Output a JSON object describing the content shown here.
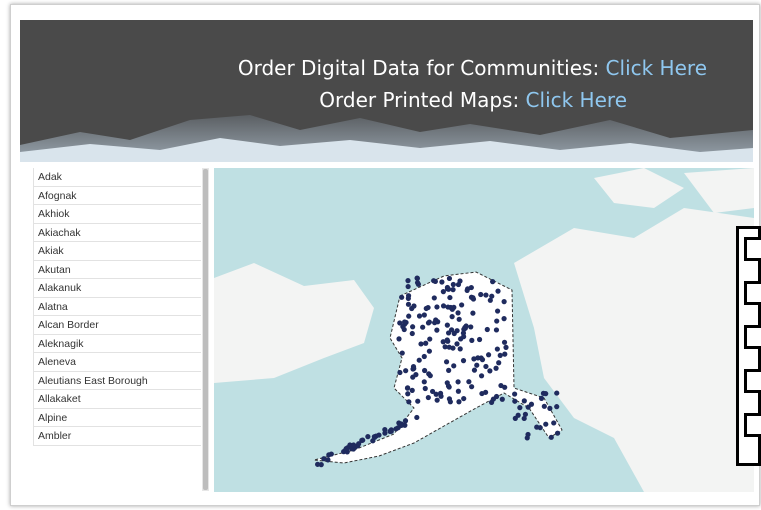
{
  "banner": {
    "line1_text": "Order Digital Data for Communities: ",
    "line1_link": "Click Here",
    "line2_text": "Order Printed Maps: ",
    "line2_link": "Click Here"
  },
  "communities": [
    "Adak",
    "Afognak",
    "Akhiok",
    "Akiachak",
    "Akiak",
    "Akutan",
    "Alakanuk",
    "Alatna",
    "Alcan Border",
    "Aleknagik",
    "Aleneva",
    "Aleutians East Borough",
    "Allakaket",
    "Alpine",
    "Ambler"
  ],
  "colors": {
    "banner_bg": "#4a4a4a",
    "link": "#8fc7ef",
    "ocean": "#bfe0e3",
    "land": "#f4f5f4",
    "marker": "#1f2b5e"
  }
}
